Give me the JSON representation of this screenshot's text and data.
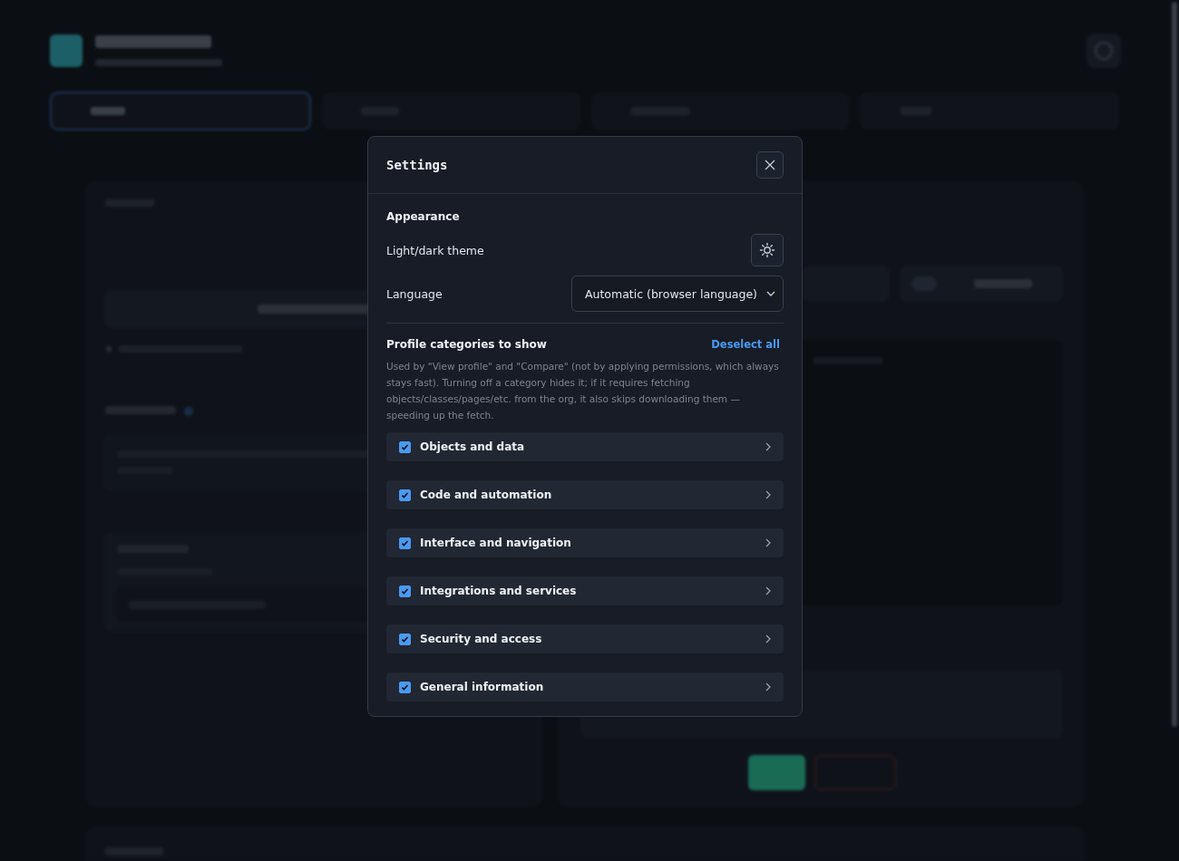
{
  "settings": {
    "title": "Settings",
    "appearance": "Appearance",
    "theme_label": "Light/dark theme",
    "language_label": "Language",
    "language_value": "Automatic (browser language)",
    "categories_title": "Profile categories to show",
    "deselect_all": "Deselect all",
    "description": "Used by \"View profile\" and \"Compare\" (not by applying permissions, which always stays fast). Turning off a category hides it; if it requires fetching objects/classes/pages/etc. from the org, it also skips downloading them — speeding up the fetch.",
    "categories": [
      {
        "label": "Objects and data",
        "checked": true
      },
      {
        "label": "Code and automation",
        "checked": true
      },
      {
        "label": "Interface and navigation",
        "checked": true
      },
      {
        "label": "Integrations and services",
        "checked": true
      },
      {
        "label": "Security and access",
        "checked": true
      },
      {
        "label": "General information",
        "checked": true
      }
    ]
  }
}
